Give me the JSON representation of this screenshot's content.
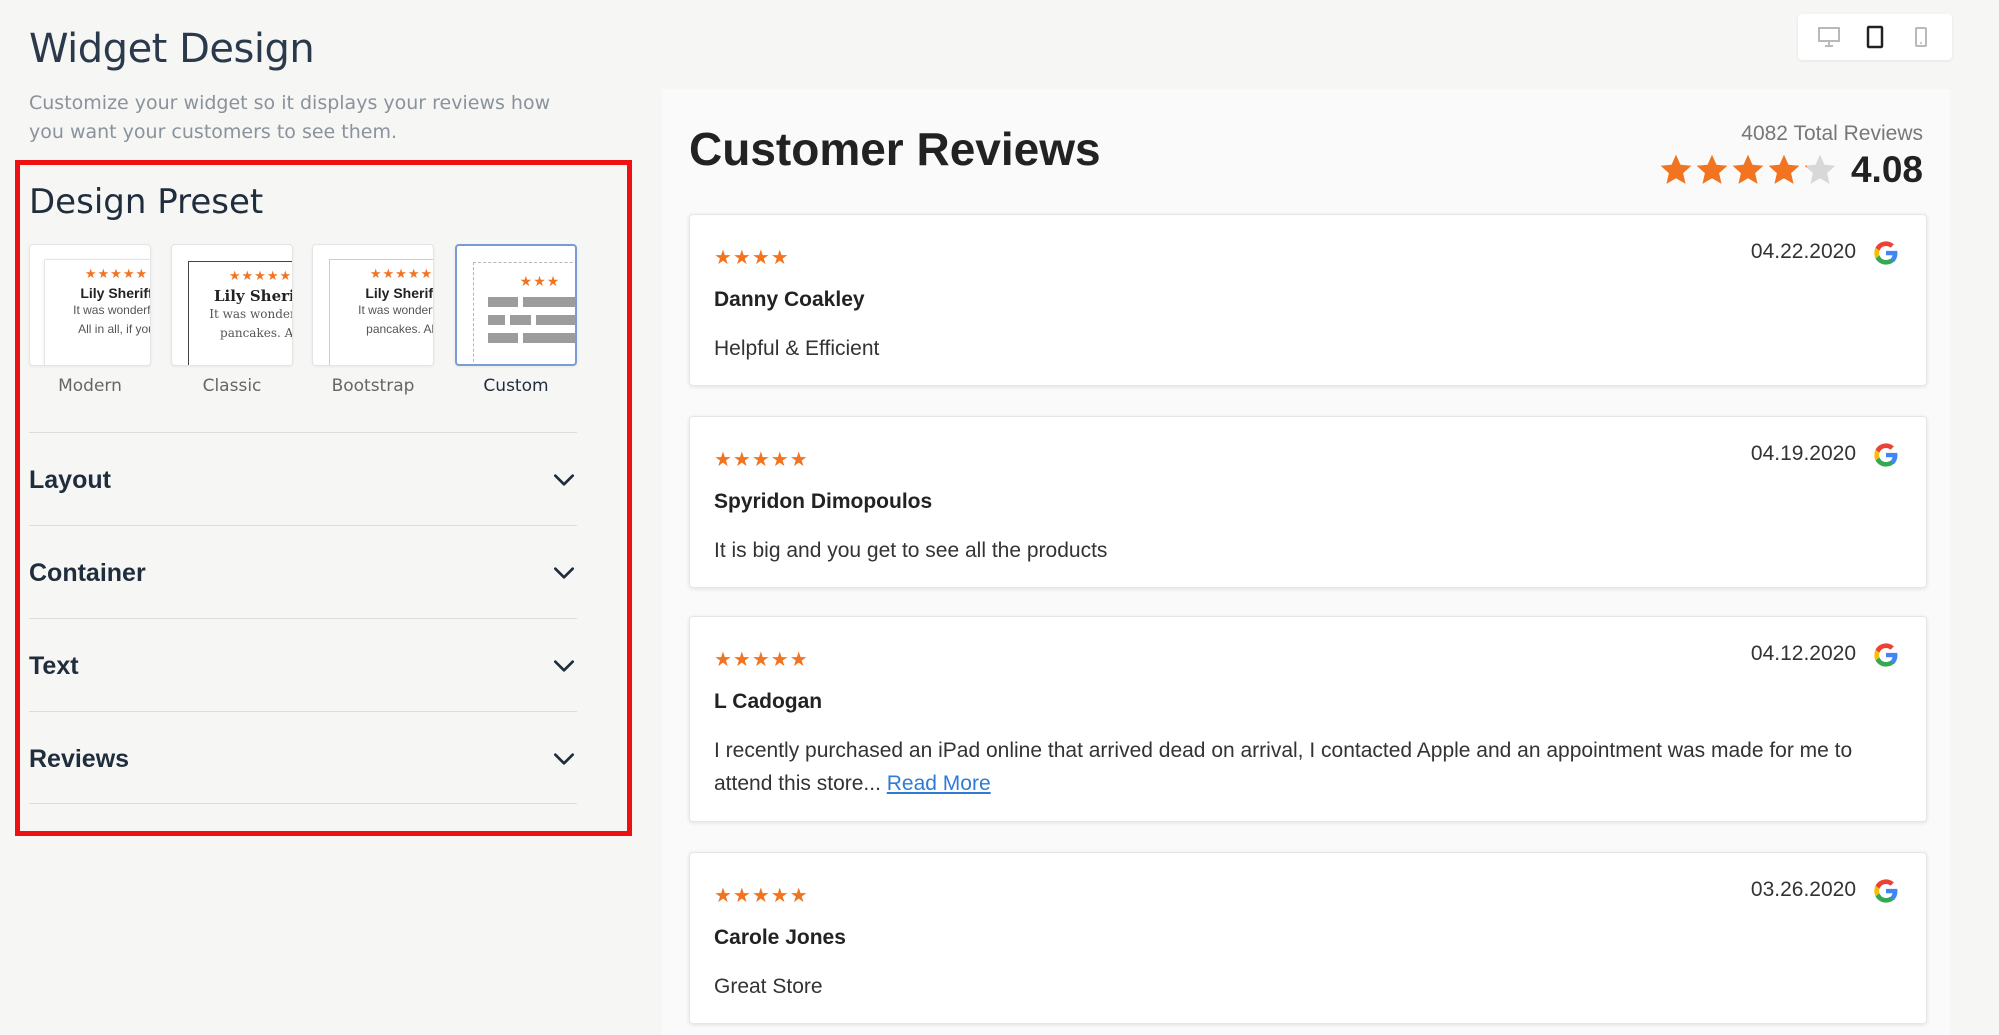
{
  "header": {
    "title": "Widget Design",
    "subtitle": "Customize your widget so it displays your reviews how you want your customers to see them."
  },
  "design_preset": {
    "title": "Design Preset",
    "presets": [
      {
        "label": "Modern",
        "selected": false,
        "thumb_name": "Lily Sheriff",
        "thumb_line1": "It was wonderful",
        "thumb_line2": "All in all, if you"
      },
      {
        "label": "Classic",
        "selected": false,
        "thumb_name": "Lily Sheriff",
        "thumb_line1": "It was wonderful",
        "thumb_line2": "pancakes. All"
      },
      {
        "label": "Bootstrap",
        "selected": false,
        "thumb_name": "Lily Sheriff",
        "thumb_line1": "It was wonderful",
        "thumb_line2": "pancakes. All"
      },
      {
        "label": "Custom",
        "selected": true
      }
    ],
    "thumb_stars": "★★★★★",
    "custom_stars": "★★★"
  },
  "accordion": [
    {
      "label": "Layout"
    },
    {
      "label": "Container"
    },
    {
      "label": "Text"
    },
    {
      "label": "Reviews"
    }
  ],
  "device_toggle": {
    "options": [
      "desktop-icon",
      "tablet-icon",
      "mobile-icon"
    ],
    "selected": "tablet-icon"
  },
  "widget": {
    "title": "Customer Reviews",
    "total_reviews": "4082 Total Reviews",
    "rating": "4.08",
    "rating_value": 4.08,
    "reviews": [
      {
        "stars": "★★★★",
        "date": "04.22.2020",
        "author": "Danny Coakley",
        "body": "Helpful & Efficient",
        "read_more": ""
      },
      {
        "stars": "★★★★★",
        "date": "04.19.2020",
        "author": "Spyridon Dimopoulos",
        "body": "It is big and you get to see all the products",
        "read_more": ""
      },
      {
        "stars": "★★★★★",
        "date": "04.12.2020",
        "author": "L Cadogan",
        "body": "I recently purchased an iPad online that arrived dead on arrival, I contacted Apple and an appointment was made for me to attend this store... ",
        "read_more": "Read More"
      },
      {
        "stars": "★★★★★",
        "date": "03.26.2020",
        "author": "Carole Jones",
        "body": "Great Store",
        "read_more": ""
      }
    ]
  },
  "colors": {
    "star": "#f27420",
    "highlight_border": "#ee1111",
    "link": "#2f7bd6"
  }
}
